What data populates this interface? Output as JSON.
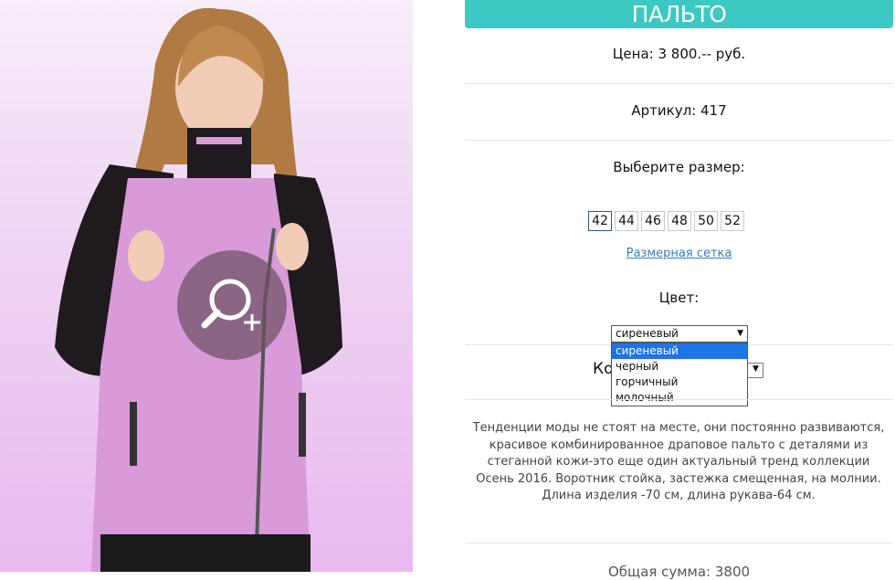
{
  "product": {
    "title": "ПАЛЬТО",
    "price": "Цена: 3 800.-- руб.",
    "article": "Артикул: 417",
    "size_label": "Выберите размер:",
    "sizes": [
      "42",
      "44",
      "46",
      "48",
      "50",
      "52"
    ],
    "size_chart_link": "Размерная сетка",
    "color_label": "Цвет:",
    "color_selected": "сиреневый",
    "color_options": [
      "сиреневый",
      "черный",
      "горчичный",
      "молочный"
    ],
    "quantity_label_partial": "Ко",
    "description": "Тенденции моды не стоят на месте, они постоянно развиваются, красивое комбинированное драповое пальто с деталями из стеганной кожи-это еще один актуальный тренд коллекции Осень 2016. Воротник стойка, застежка смещенная, на молнии. Длина изделия -70 см, длина рукава-64 см.",
    "footer_partial": "Общая сумма: 3800"
  },
  "colors": {
    "title_bg": "#3cc9c3",
    "coat": "#d89ad8",
    "sleeves": "#1f1a1e",
    "dropdown_highlight": "#1e73e8"
  }
}
